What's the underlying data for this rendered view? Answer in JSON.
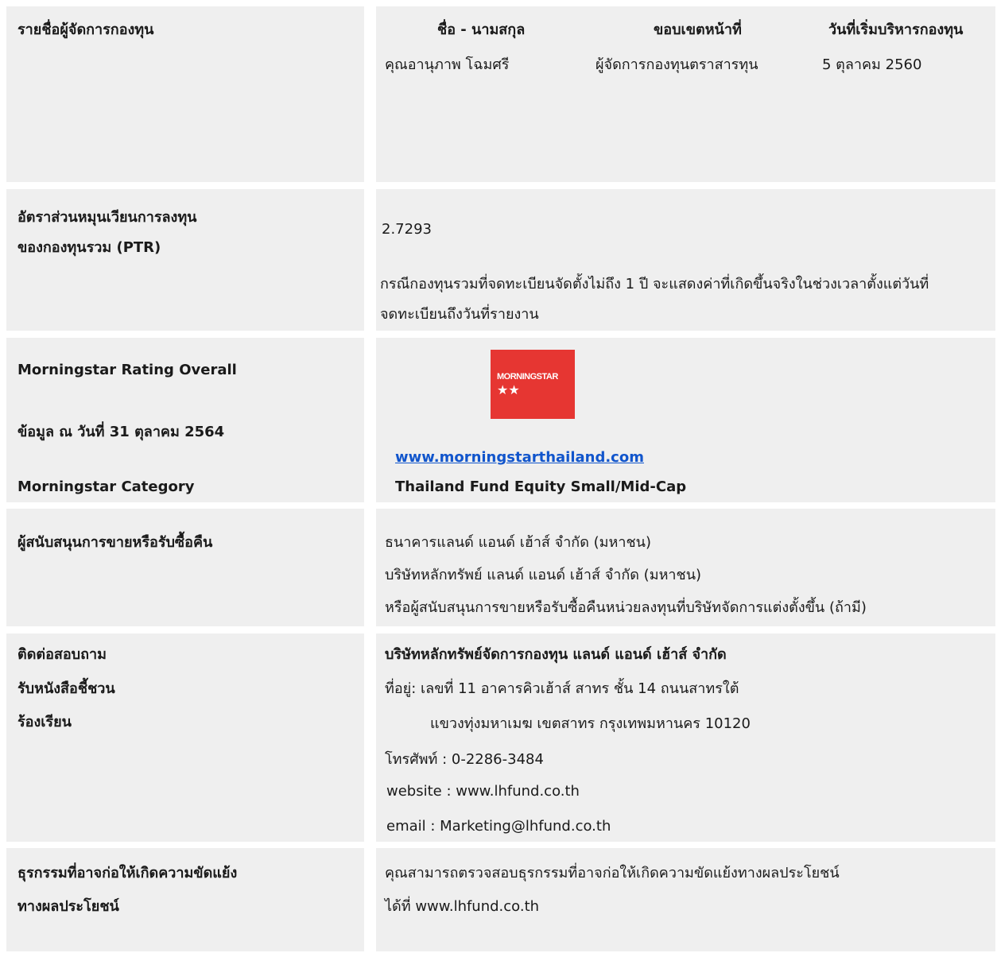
{
  "managers": {
    "label": "รายชื่อผู้จัดการกองทุน",
    "columns": [
      "ชื่อ - นามสกุล",
      "ขอบเขตหน้าที่",
      "วันที่เริ่มบริหารกองทุน"
    ],
    "row": {
      "name": "คุณอานุภาพ โฉมศรี",
      "scope": "ผู้จัดการกองทุนตราสารทุน",
      "start": "5 ตุลาคม 2560"
    }
  },
  "ptr": {
    "label_line1": "อัตราส่วนหมุนเวียนการลงทุน",
    "label_line2": "ของกองทุนรวม (PTR)",
    "value": "2.7293",
    "note_line1": "กรณีกองทุนรวมที่จดทะเบียนจัดตั้งไม่ถึง 1 ปี จะแสดงค่าที่เกิดขึ้นจริงในช่วงเวลาตั้งแต่วันที่",
    "note_line2": "จดทะเบียนถึงวันที่รายงาน"
  },
  "morningstar": {
    "rating_label": "Morningstar Rating Overall",
    "as_of_label": "ข้อมูล ณ วันที่ 31 ตุลาคม 2564",
    "category_label": "Morningstar Category",
    "logo_text": "MORNINGSTAR",
    "stars": "★★",
    "rating_stars": 2,
    "website": "www.morningstarthailand.com",
    "category": "Thailand Fund Equity Small/Mid-Cap",
    "brand_color": "#e63632"
  },
  "distributors": {
    "label": "ผู้สนับสนุนการขายหรือรับซื้อคืน",
    "lines": [
      "ธนาคารแลนด์ แอนด์ เฮ้าส์ จำกัด (มหาชน)",
      "บริษัทหลักทรัพย์ แลนด์ แอนด์ เฮ้าส์ จำกัด (มหาชน)",
      "หรือผู้สนับสนุนการขายหรือรับซื้อคืนหน่วยลงทุนที่บริษัทจัดการแต่งตั้งขึ้น (ถ้ามี)"
    ]
  },
  "contact": {
    "labels": [
      "ติดต่อสอบถาม",
      "รับหนังสือชี้ชวน",
      "ร้องเรียน"
    ],
    "company": "บริษัทหลักทรัพย์จัดการกองทุน แลนด์ แอนด์ เฮ้าส์ จำกัด",
    "address1": "ที่อยู่: เลขที่ 11 อาคารคิวเฮ้าส์ สาทร ชั้น 14  ถนนสาทรใต้",
    "address2": "แขวงทุ่งมหาเมฆ  เขตสาทร กรุงเทพมหานคร  10120",
    "phone": "โทรศัพท์ : 0-2286-3484",
    "website": "website : www.lhfund.co.th",
    "email": "email : Marketing@lhfund.co.th"
  },
  "conflict": {
    "label_line1": "ธุรกรรมที่อาจก่อให้เกิดความขัดแย้ง",
    "label_line2": "ทางผลประโยชน์",
    "text_line1": "คุณสามารถตรวจสอบธุรกรรมที่อาจก่อให้เกิดความขัดแย้งทางผลประโยชน์",
    "text_line2": "ได้ที่ www.lhfund.co.th"
  }
}
